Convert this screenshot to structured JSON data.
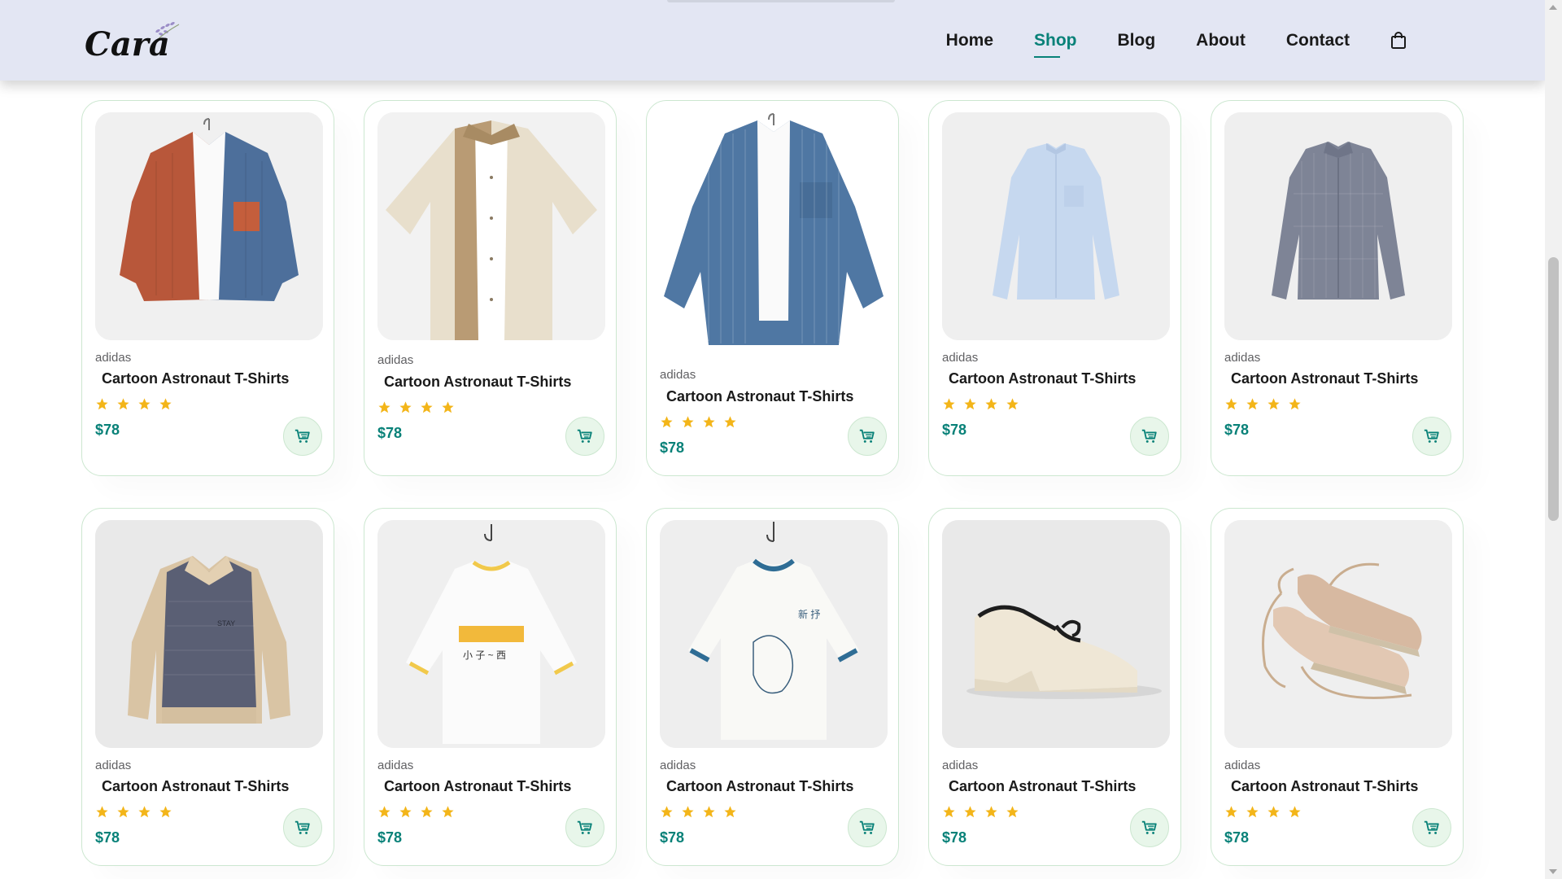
{
  "header": {
    "logo_text": "Cara",
    "nav": [
      {
        "label": "Home",
        "active": false
      },
      {
        "label": "Shop",
        "active": true
      },
      {
        "label": "Blog",
        "active": false
      },
      {
        "label": "About",
        "active": false
      },
      {
        "label": "Contact",
        "active": false
      }
    ],
    "cart_icon": "shopping-bag-icon"
  },
  "colors": {
    "accent": "#088178",
    "header_bg": "#e3e6f3",
    "star": "#f3b519",
    "cart_bg": "#e8f6ea",
    "card_border": "#cce7d0"
  },
  "products": [
    {
      "brand": "adidas",
      "title": "Cartoon Astronaut T-Shirts",
      "rating": 4,
      "price": "$78",
      "image": "rust-blue-corduroy-shirt"
    },
    {
      "brand": "adidas",
      "title": "Cartoon Astronaut T-Shirts",
      "rating": 4,
      "price": "$78",
      "image": "beige-tan-short-sleeve-shirt"
    },
    {
      "brand": "adidas",
      "title": "Cartoon Astronaut T-Shirts",
      "rating": 4,
      "price": "$78",
      "image": "blue-striped-overshirt"
    },
    {
      "brand": "adidas",
      "title": "Cartoon Astronaut T-Shirts",
      "rating": 4,
      "price": "$78",
      "image": "light-blue-band-collar-shirt"
    },
    {
      "brand": "adidas",
      "title": "Cartoon Astronaut T-Shirts",
      "rating": 4,
      "price": "$78",
      "image": "grey-check-shirt"
    },
    {
      "brand": "adidas",
      "title": "Cartoon Astronaut T-Shirts",
      "rating": 4,
      "price": "$78",
      "image": "knit-polo-sweater"
    },
    {
      "brand": "adidas",
      "title": "Cartoon Astronaut T-Shirts",
      "rating": 4,
      "price": "$78",
      "image": "white-yellow-print-tee"
    },
    {
      "brand": "adidas",
      "title": "Cartoon Astronaut T-Shirts",
      "rating": 4,
      "price": "$78",
      "image": "white-blue-print-tee"
    },
    {
      "brand": "adidas",
      "title": "Cartoon Astronaut T-Shirts",
      "rating": 4,
      "price": "$78",
      "image": "cream-platform-loafer"
    },
    {
      "brand": "adidas",
      "title": "Cartoon Astronaut T-Shirts",
      "rating": 4,
      "price": "$78",
      "image": "lace-up-espadrilles"
    }
  ]
}
